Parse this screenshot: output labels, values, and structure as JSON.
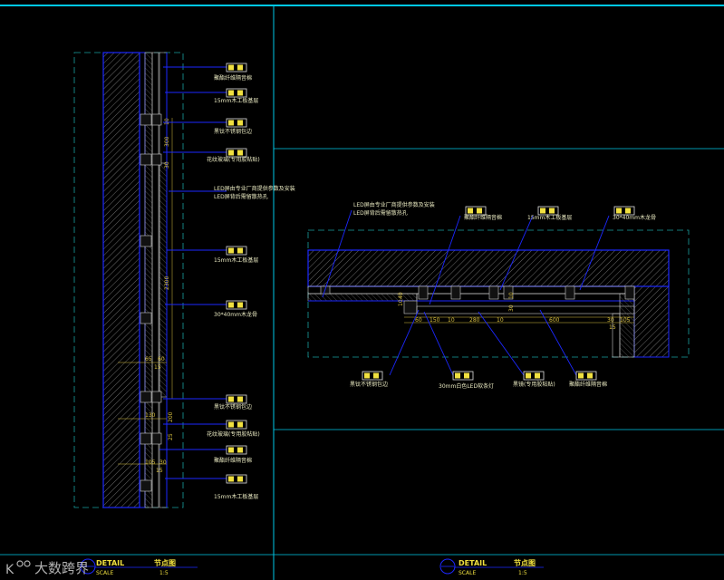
{
  "left_detail": {
    "labels": [
      "聚酯纤维隔音棉",
      "15mm木工板基层",
      "黑钛不锈钢包边",
      "花纹玻璃(专用胶粘贴)",
      "LED屏由专业厂商提供参数及安装",
      "LED屏背后需留散热孔",
      "15mm木工板基层",
      "30*40mm木龙骨",
      "黑钛不锈钢包边",
      "花纹玻璃(专用胶粘贴)",
      "聚酯纤维隔音棉",
      "15mm木工板基层"
    ],
    "dims": [
      "10",
      "300",
      "30",
      "2300",
      "65",
      "60",
      "15",
      "130",
      "200",
      "25",
      "105",
      "30",
      "15"
    ]
  },
  "right_detail": {
    "labels_top": [
      "LED屏由专业厂商提供参数及安装",
      "LED屏背后需留散热孔",
      "聚酯纤维隔音棉",
      "15mm木工板基层",
      "30*40mm木龙骨"
    ],
    "labels_bottom": [
      "黑钛不锈钢包边",
      "30mm白色LED软条灯",
      "黑镜(专用胶粘贴)",
      "聚酯纤维隔音棉"
    ],
    "dims": [
      "40",
      "10",
      "60",
      "150",
      "10",
      "280",
      "10",
      "600",
      "30",
      "105",
      "15",
      "10",
      "30"
    ]
  },
  "footer": {
    "left": {
      "detail": "DETAIL",
      "scale": "SCALE",
      "name": "节点图",
      "ratio": "1:5"
    },
    "right": {
      "detail": "DETAIL",
      "scale": "SCALE",
      "name": "节点图",
      "ratio": "1:5"
    }
  },
  "watermark": {
    "brand": "大数跨界"
  },
  "colors": {
    "border": "#00c8e8",
    "blue": "#1c28ff",
    "yellow": "#f0e040",
    "hatch": "#707070"
  }
}
